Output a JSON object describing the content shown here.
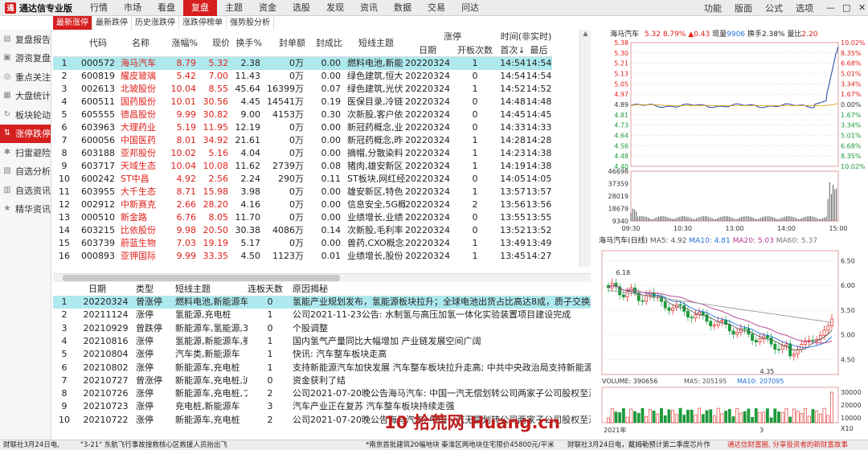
{
  "app": {
    "title": "通达信专业版",
    "logo_text": "通"
  },
  "menu": [
    {
      "label": "行情",
      "active": false
    },
    {
      "label": "市场",
      "active": false
    },
    {
      "label": "看盘",
      "active": false
    },
    {
      "label": "复盘",
      "active": true
    },
    {
      "label": "主题",
      "active": false
    },
    {
      "label": "资金",
      "active": false
    },
    {
      "label": "选股",
      "active": false
    },
    {
      "label": "发现",
      "active": false
    },
    {
      "label": "资讯",
      "active": false
    },
    {
      "label": "数据",
      "active": false
    },
    {
      "label": "交易",
      "active": false
    },
    {
      "label": "问达",
      "active": false
    }
  ],
  "right_menu": [
    "功能",
    "版面",
    "公式",
    "选项"
  ],
  "window_buttons": [
    "—",
    "□",
    "✕"
  ],
  "subtabs": [
    {
      "label": "最新涨停",
      "active": true
    },
    {
      "label": "最新跌停",
      "active": false
    },
    {
      "label": "历史涨跌停",
      "active": false
    },
    {
      "label": "涨跌停榜单",
      "active": false
    },
    {
      "label": "强势股分析",
      "active": false
    }
  ],
  "sidebar": [
    {
      "label": "复盘报告",
      "icon": "report-icon",
      "glyph": "▤",
      "active": false
    },
    {
      "label": "游资复盘",
      "icon": "money-icon",
      "glyph": "▣",
      "active": false
    },
    {
      "label": "重点关注",
      "icon": "focus-icon",
      "glyph": "◎",
      "active": false
    },
    {
      "label": "大盘统计",
      "icon": "stats-icon",
      "glyph": "▦",
      "active": false
    },
    {
      "label": "板块轮动",
      "icon": "rotate-icon",
      "glyph": "↻",
      "active": false
    },
    {
      "label": "涨停跌停",
      "icon": "limit-icon",
      "glyph": "⇅",
      "active": true
    },
    {
      "label": "扫雷避险",
      "icon": "mine-icon",
      "glyph": "✱",
      "active": false
    },
    {
      "label": "自选分析",
      "icon": "analysis-icon",
      "glyph": "▧",
      "active": false
    },
    {
      "label": "自选资讯",
      "icon": "news-icon",
      "glyph": "▥",
      "active": false
    },
    {
      "label": "精华资讯",
      "icon": "star-icon",
      "glyph": "★",
      "active": false
    }
  ],
  "table": {
    "headers": [
      "代码",
      "名称",
      "涨幅%",
      "现价",
      "换手%",
      "封单额",
      "封成比",
      "短线主题"
    ],
    "group_header": "涨停",
    "sub_headers": [
      "日期",
      "开板次数"
    ],
    "time_header": "时间(非实时)",
    "time_sub": [
      "首次↓",
      "最后"
    ],
    "rows": [
      {
        "idx": "1",
        "code": "000572",
        "name": "海马汽车",
        "pct": "8.79",
        "price": "5.32",
        "turn": "2.38",
        "seal": "0万",
        "ratio": "0.00",
        "theme": "燃料电池,新能",
        "date": "20220324",
        "opens": "1",
        "first": "14:54",
        "last": "14:54"
      },
      {
        "idx": "2",
        "code": "600819",
        "name": "耀皮玻璃",
        "pct": "5.42",
        "price": "7.00",
        "turn": "11.43",
        "seal": "0万",
        "ratio": "0.00",
        "theme": "绿色建筑,恒大",
        "date": "20220324",
        "opens": "0",
        "first": "14:54",
        "last": "14:54"
      },
      {
        "idx": "3",
        "code": "002613",
        "name": "北玻股份",
        "pct": "10.04",
        "price": "8.55",
        "turn": "45.64",
        "seal": "16399万",
        "ratio": "0.07",
        "theme": "绿色建筑,光伏",
        "date": "20220324",
        "opens": "1",
        "first": "14:52",
        "last": "14:52"
      },
      {
        "idx": "4",
        "code": "600511",
        "name": "国药股份",
        "pct": "10.01",
        "price": "30.56",
        "turn": "4.45",
        "seal": "14541万",
        "ratio": "0.19",
        "theme": "医保目录,冷链",
        "date": "20220324",
        "opens": "0",
        "first": "14:48",
        "last": "14:48"
      },
      {
        "idx": "5",
        "code": "605555",
        "name": "德昌股份",
        "pct": "9.99",
        "price": "30.82",
        "turn": "9.00",
        "seal": "4153万",
        "ratio": "0.30",
        "theme": "次新股,客户依",
        "date": "20220324",
        "opens": "0",
        "first": "14:45",
        "last": "14:45"
      },
      {
        "idx": "6",
        "code": "603963",
        "name": "大理药业",
        "pct": "5.19",
        "price": "11.95",
        "turn": "12.19",
        "seal": "0万",
        "ratio": "0.00",
        "theme": "新冠药概念,业",
        "date": "20220324",
        "opens": "0",
        "first": "14:33",
        "last": "14:33"
      },
      {
        "idx": "7",
        "code": "600056",
        "name": "中国医药",
        "pct": "8.01",
        "price": "34.92",
        "turn": "21.61",
        "seal": "0万",
        "ratio": "0.00",
        "theme": "新冠药概念,昨",
        "date": "20220324",
        "opens": "1",
        "first": "14:28",
        "last": "14:28"
      },
      {
        "idx": "8",
        "code": "603188",
        "name": "亚邦股份",
        "pct": "10.02",
        "price": "5.16",
        "turn": "4.04",
        "seal": "0万",
        "ratio": "0.00",
        "theme": "摘帽,分散染料",
        "date": "20220324",
        "opens": "1",
        "first": "14:23",
        "last": "14:38"
      },
      {
        "idx": "9",
        "code": "603717",
        "name": "天域生态",
        "pct": "10.04",
        "price": "10.08",
        "turn": "11.62",
        "seal": "2739万",
        "ratio": "0.08",
        "theme": "猪肉,雄安新区",
        "date": "20220324",
        "opens": "1",
        "first": "14:19",
        "last": "14:38"
      },
      {
        "idx": "10",
        "code": "600242",
        "name": "ST中昌",
        "pct": "4.92",
        "price": "2.56",
        "turn": "2.24",
        "seal": "290万",
        "ratio": "0.11",
        "theme": "ST板块,网红经",
        "date": "20220324",
        "opens": "0",
        "first": "14:05",
        "last": "14:05"
      },
      {
        "idx": "11",
        "code": "603955",
        "name": "大千生态",
        "pct": "8.71",
        "price": "15.98",
        "turn": "3.98",
        "seal": "0万",
        "ratio": "0.00",
        "theme": "雄安新区,特色",
        "date": "20220324",
        "opens": "1",
        "first": "13:57",
        "last": "13:57"
      },
      {
        "idx": "12",
        "code": "002912",
        "name": "中新赛克",
        "pct": "2.66",
        "price": "28.20",
        "turn": "4.16",
        "seal": "0万",
        "ratio": "0.00",
        "theme": "信息安全,5G概",
        "date": "20220324",
        "opens": "2",
        "first": "13:56",
        "last": "13:56"
      },
      {
        "idx": "13",
        "code": "000510",
        "name": "新金路",
        "pct": "6.76",
        "price": "8.05",
        "turn": "11.70",
        "seal": "0万",
        "ratio": "0.00",
        "theme": "业绩增长,业绩",
        "date": "20220324",
        "opens": "0",
        "first": "13:55",
        "last": "13:55"
      },
      {
        "idx": "14",
        "code": "603215",
        "name": "比依股份",
        "pct": "9.98",
        "price": "20.50",
        "turn": "30.38",
        "seal": "4086万",
        "ratio": "0.14",
        "theme": "次新股,毛利率",
        "date": "20220324",
        "opens": "0",
        "first": "13:52",
        "last": "13:52"
      },
      {
        "idx": "15",
        "code": "603739",
        "name": "蔚蓝生物",
        "pct": "7.03",
        "price": "19.19",
        "turn": "5.17",
        "seal": "0万",
        "ratio": "0.00",
        "theme": "兽药,CXO概念,",
        "date": "20220324",
        "opens": "1",
        "first": "13:49",
        "last": "13:49"
      },
      {
        "idx": "16",
        "code": "000893",
        "name": "亚钾国际",
        "pct": "9.99",
        "price": "33.35",
        "turn": "4.50",
        "seal": "1123万",
        "ratio": "0.01",
        "theme": "业绩增长,股份",
        "date": "20220324",
        "opens": "1",
        "first": "13:45",
        "last": "14:27"
      }
    ]
  },
  "history": {
    "headers": [
      "日期",
      "类型",
      "短线主题",
      "连板天数",
      "原因揭秘"
    ],
    "rows": [
      {
        "idx": "1",
        "date": "20220324",
        "type": "曾涨停",
        "theme": "燃料电池,新能源车",
        "days": "0",
        "reason": "氢能产业规划发布，氢能源板块拉升；全球电池出货占比高达8成，质子交换膜重"
      },
      {
        "idx": "2",
        "date": "20211124",
        "type": "涨停",
        "theme": "氢能源,充电桩",
        "days": "1",
        "reason": "公司2021-11-23公告: 水制氢与高压加氢一体化实验装置项目建设完成"
      },
      {
        "idx": "3",
        "date": "20210929",
        "type": "曾跌停",
        "theme": "新能源车,氢能源,3",
        "days": "0",
        "reason": "个股调整"
      },
      {
        "idx": "4",
        "date": "20210816",
        "type": "涨停",
        "theme": "氢能源,新能源车,虱",
        "days": "1",
        "reason": "国内氢气产量同比大幅增加 产业链发展空间广阔"
      },
      {
        "idx": "5",
        "date": "20210804",
        "type": "涨停",
        "theme": "汽车类,新能源车",
        "days": "1",
        "reason": "快讯: 汽车整车板块走高"
      },
      {
        "idx": "6",
        "date": "20210802",
        "type": "涨停",
        "theme": "新能源车,充电桩",
        "days": "1",
        "reason": "支持新能源汽车加快发展 汽车整车板块拉升走高; 中共中央政治局支持新能源汽"
      },
      {
        "idx": "7",
        "date": "20210727",
        "type": "曾涨停",
        "theme": "新能源车,充电桩,沪",
        "days": "0",
        "reason": "资金获利了结"
      },
      {
        "idx": "8",
        "date": "20210726",
        "type": "涨停",
        "theme": "新能源车,充电桩,フ",
        "days": "2",
        "reason": "公司2021-07-20晚公告海马汽车: 中国一汽无偿划转公司两家子公司股权至海南"
      },
      {
        "idx": "9",
        "date": "20210723",
        "type": "涨停",
        "theme": "充电桩,新能源车",
        "days": "3",
        "reason": "汽车产业正在复苏 汽车整车板块持续走强"
      },
      {
        "idx": "10",
        "date": "20210722",
        "type": "涨停",
        "theme": "新能源车,充电桩",
        "days": "2",
        "reason": "公司2021-07-20晚公告海马汽车: 中国一汽无偿划转公司两家子公司股权至海南"
      }
    ]
  },
  "intraday": {
    "name": "海马汽车",
    "price": "5.32",
    "pct": "8.79%",
    "change": "▲0.43",
    "vol_label": "现量",
    "vol": "9906",
    "turn_label": "换手",
    "turn": "2.38%",
    "ratio_label": "量比",
    "ratio": "2.20",
    "left_ticks": [
      "5.38",
      "5.30",
      "5.21",
      "5.13",
      "5.05",
      "4.97",
      "4.89",
      "4.81",
      "4.73",
      "4.64",
      "4.56",
      "4.48",
      "4.40"
    ],
    "right_ticks": [
      "10.02%",
      "8.35%",
      "6.68%",
      "5.01%",
      "3.34%",
      "1.67%",
      "0.00%",
      "1.67%",
      "3.34%",
      "5.01%",
      "6.68%",
      "8.35%",
      "10.02%"
    ],
    "vol_ticks": [
      "46698",
      "37359",
      "28019",
      "18679",
      "9340"
    ],
    "time_ticks": [
      "09:30",
      "10:30",
      "13:00",
      "14:00",
      "15:00"
    ],
    "close_prev": 4.89
  },
  "daily": {
    "title": "海马汽车(日线)",
    "ma": [
      {
        "label": "MA5: 4.92",
        "color": "#555555"
      },
      {
        "label": "MA10: 4.81",
        "color": "#1f6fd6"
      },
      {
        "label": "MA20: 5.03",
        "color": "#b4398e"
      },
      {
        "label": "MA60: 5.37",
        "color": "#777777"
      }
    ],
    "price_ticks": [
      "6.50",
      "6.00",
      "5.50",
      "5.00",
      "4.50"
    ],
    "high_label": "6.18",
    "low_label": "4.35",
    "vol_title": "VOLUME: 390656",
    "vol_ma5": "MA5: 205195",
    "vol_ma10": "MA10: 207095",
    "vol_ticks": [
      "30000",
      "20000",
      "10000"
    ],
    "vol_unit": "X10",
    "x_labels": [
      "2021年",
      "3"
    ]
  },
  "statusbar": [
    "财联社3月24日电,",
    "\"3-21\" 东航飞行事故搜救核心区救援人员抬出飞",
    "*南京首批建筑20幅地块 秦淮区两地块住宅限价45800元/平米",
    "财联社3月24日电，戴姆勒预计第二季度芯片作",
    "通达信财富圈, 分享投资者的新财富故事"
  ],
  "watermark": "10 拾荒网 Huang.cn",
  "colors": {
    "accent": "#d61f1f",
    "up": "#e0201b",
    "down": "#1d9a3a",
    "selected_row": "#aee9ee"
  }
}
